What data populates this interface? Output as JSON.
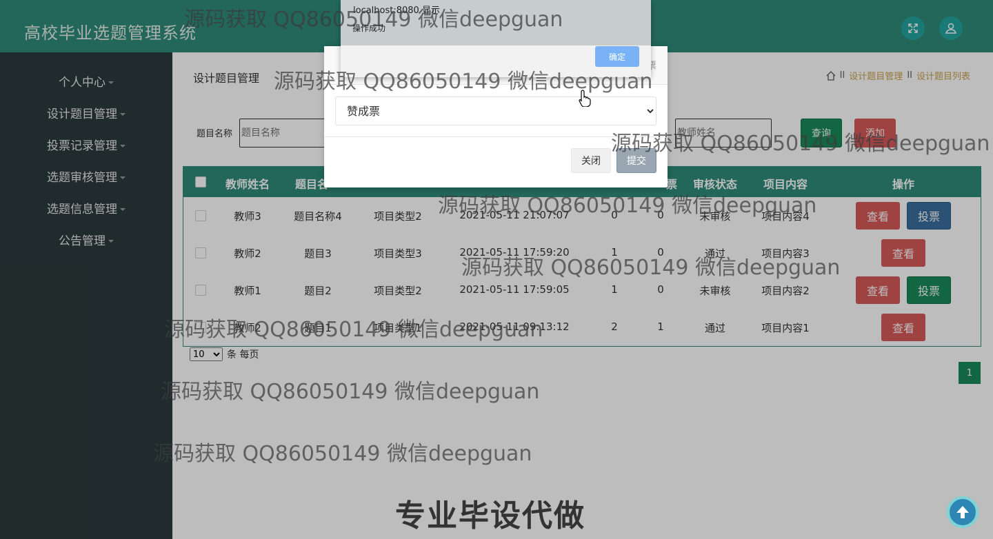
{
  "header": {
    "title": "高校毕业选题管理系统"
  },
  "sidebar": {
    "items": [
      {
        "label": "个人中心"
      },
      {
        "label": "设计题目管理"
      },
      {
        "label": "投票记录管理"
      },
      {
        "label": "选题审核管理"
      },
      {
        "label": "选题信息管理"
      },
      {
        "label": "公告管理"
      }
    ]
  },
  "page": {
    "title": "设计题目管理",
    "breadcrumb": [
      "设计题目管理",
      "设计题目列表"
    ],
    "separator": "II"
  },
  "filters": {
    "title_label": "题目名称",
    "title_placeholder": "题目名称",
    "teacher_placeholder": "教师姓名",
    "search_label": "查询",
    "add_label": "添加"
  },
  "table": {
    "headers": [
      "教师姓名",
      "题目名",
      "票",
      "审核状态",
      "项目内容",
      "操作"
    ],
    "rows": [
      {
        "teacher": "教师3",
        "topic": "题目名称4",
        "type": "项目类型2",
        "time": "2021-05-11 21:07:07",
        "votes_for": "0",
        "votes_against": "0",
        "status": "未审核",
        "content": "项目内容4",
        "view": "查看",
        "vote": "投票"
      },
      {
        "teacher": "教师2",
        "topic": "题目3",
        "type": "项目类型3",
        "time": "2021-05-11 17:59:20",
        "votes_for": "1",
        "votes_against": "0",
        "status": "通过",
        "content": "项目内容3",
        "view": "查看"
      },
      {
        "teacher": "教师1",
        "topic": "题目2",
        "type": "项目类型2",
        "time": "2021-05-11 17:59:05",
        "votes_for": "1",
        "votes_against": "0",
        "status": "未审核",
        "content": "项目内容2",
        "view": "查看",
        "vote": "投票"
      },
      {
        "teacher": "教师2",
        "topic": "题目1",
        "type": "项目类型1",
        "time": "2021-05-11 09:13:12",
        "votes_for": "2",
        "votes_against": "1",
        "status": "通过",
        "content": "项目内容1",
        "view": "查看"
      }
    ]
  },
  "pagination": {
    "page_size": "10",
    "per_page_text": "条 每页",
    "current_page": "1"
  },
  "vote_modal": {
    "title": "投票",
    "select_value": "赞成票",
    "close_label": "关闭",
    "submit_label": "提交"
  },
  "alert": {
    "title": "localhost:8080 显示",
    "message": "操作成功",
    "ok_label": "确定"
  },
  "watermark": "源码获取 QQ86050149 微信deepguan",
  "banner": "专业毕设代做",
  "colors": {
    "primary": "#2e8b7a",
    "sidebar": "#2b3a3c",
    "danger": "#d55a5a",
    "success": "#1a8a5a",
    "accent": "#caa24c"
  }
}
